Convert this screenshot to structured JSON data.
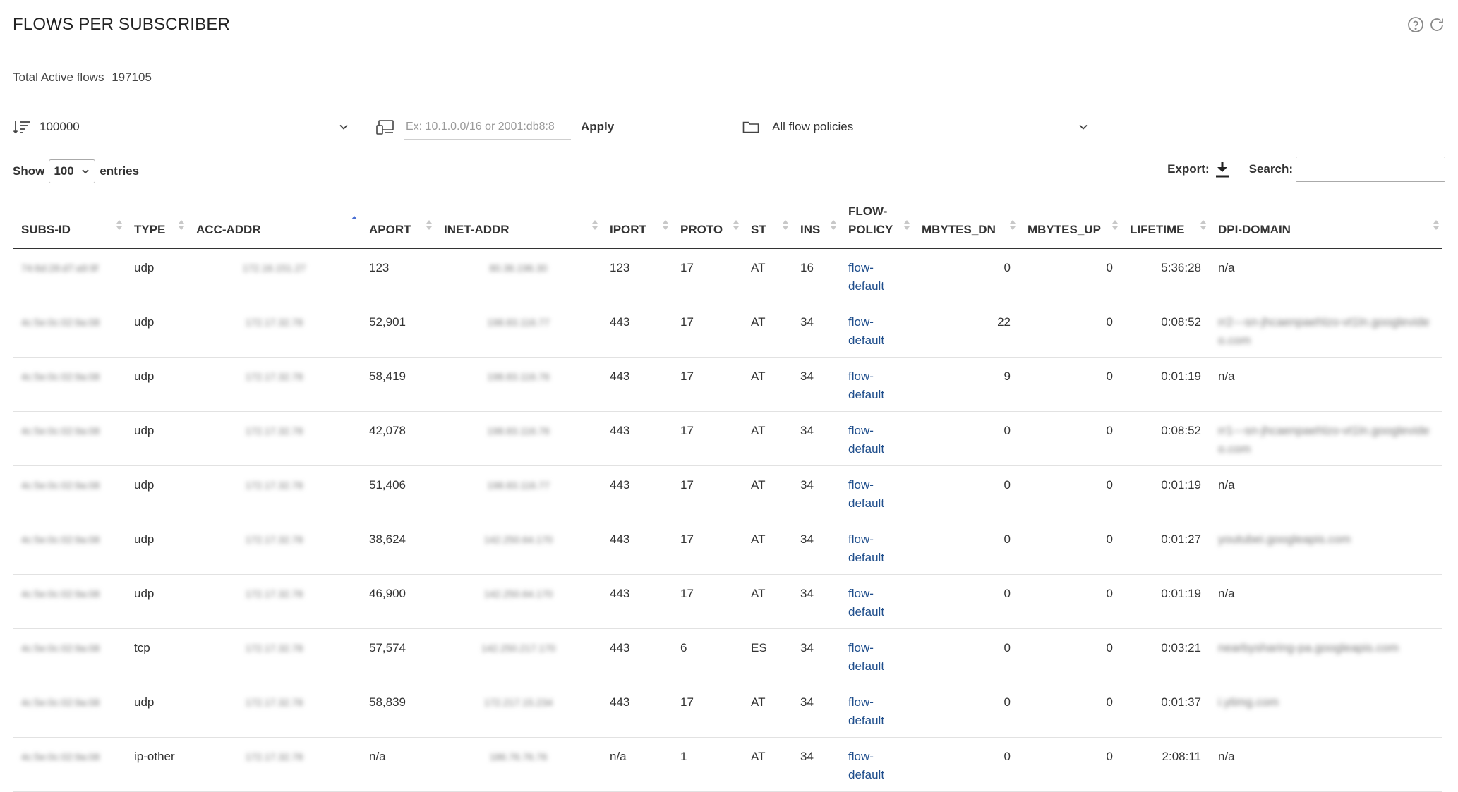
{
  "page": {
    "title": "FLOWS PER SUBSCRIBER"
  },
  "header_icons": [
    "help-circle-icon",
    "refresh-icon"
  ],
  "summary": {
    "label": "Total Active flows",
    "value": "197105"
  },
  "filters": {
    "limit_value": "100000",
    "address_placeholder": "Ex: 10.1.0.0/16 or 2001:db8:8",
    "address_value": "",
    "apply_label": "Apply",
    "policy_value": "All flow policies"
  },
  "table_controls": {
    "show_label": "Show",
    "entries_value": "100",
    "entries_label": "entries",
    "export_label": "Export:",
    "search_label": "Search:",
    "search_value": ""
  },
  "columns": [
    "SUBS-ID",
    "TYPE",
    "ACC-ADDR",
    "APORT",
    "INET-ADDR",
    "IPORT",
    "PROTO",
    "ST",
    "INS",
    "FLOW-POLICY",
    "MBYTES_DN",
    "MBYTES_UP",
    "LIFETIME",
    "DPI-DOMAIN"
  ],
  "sorted_column": "ACC-ADDR",
  "colors": {
    "link": "#1f4e8c",
    "sort_active": "#4a6fd4",
    "sort_idle": "#c8c8c8"
  },
  "rows": [
    {
      "subs_id": "74:6d:28:d7:a9:9f",
      "type": "udp",
      "acc_addr": "172.16.151.27",
      "aport": "123",
      "inet_addr": "80.36.196.30",
      "iport": "123",
      "proto": "17",
      "st": "AT",
      "ins": "16",
      "flow_policy": "flow-default",
      "mbytes_dn": "0",
      "mbytes_up": "0",
      "lifetime": "5:36:28",
      "dpi_domain": "n/a",
      "dpi_blur": false
    },
    {
      "subs_id": "4c:5e:0c:02:9a:08",
      "type": "udp",
      "acc_addr": "172.17.32.78",
      "aport": "52,901",
      "inet_addr": "198.83.116.77",
      "iport": "443",
      "proto": "17",
      "st": "AT",
      "ins": "34",
      "flow_policy": "flow-default",
      "mbytes_dn": "22",
      "mbytes_up": "0",
      "lifetime": "0:08:52",
      "dpi_domain": "rr2---sn-jhcaenpaehlzo-vt1ln.googlevideo.com",
      "dpi_blur": true
    },
    {
      "subs_id": "4c:5e:0c:02:9a:08",
      "type": "udp",
      "acc_addr": "172.17.32.78",
      "aport": "58,419",
      "inet_addr": "198.83.116.76",
      "iport": "443",
      "proto": "17",
      "st": "AT",
      "ins": "34",
      "flow_policy": "flow-default",
      "mbytes_dn": "9",
      "mbytes_up": "0",
      "lifetime": "0:01:19",
      "dpi_domain": "n/a",
      "dpi_blur": false
    },
    {
      "subs_id": "4c:5e:0c:02:9a:08",
      "type": "udp",
      "acc_addr": "172.17.32.78",
      "aport": "42,078",
      "inet_addr": "198.83.116.76",
      "iport": "443",
      "proto": "17",
      "st": "AT",
      "ins": "34",
      "flow_policy": "flow-default",
      "mbytes_dn": "0",
      "mbytes_up": "0",
      "lifetime": "0:08:52",
      "dpi_domain": "rr1---sn-jhcaenpaehlzo-vt1ln.googlevideo.com",
      "dpi_blur": true
    },
    {
      "subs_id": "4c:5e:0c:02:9a:08",
      "type": "udp",
      "acc_addr": "172.17.32.78",
      "aport": "51,406",
      "inet_addr": "198.83.116.77",
      "iport": "443",
      "proto": "17",
      "st": "AT",
      "ins": "34",
      "flow_policy": "flow-default",
      "mbytes_dn": "0",
      "mbytes_up": "0",
      "lifetime": "0:01:19",
      "dpi_domain": "n/a",
      "dpi_blur": false
    },
    {
      "subs_id": "4c:5e:0c:02:9a:08",
      "type": "udp",
      "acc_addr": "172.17.32.78",
      "aport": "38,624",
      "inet_addr": "142.250.64.170",
      "iport": "443",
      "proto": "17",
      "st": "AT",
      "ins": "34",
      "flow_policy": "flow-default",
      "mbytes_dn": "0",
      "mbytes_up": "0",
      "lifetime": "0:01:27",
      "dpi_domain": "youtubei.googleapis.com",
      "dpi_blur": true
    },
    {
      "subs_id": "4c:5e:0c:02:9a:08",
      "type": "udp",
      "acc_addr": "172.17.32.78",
      "aport": "46,900",
      "inet_addr": "142.250.64.170",
      "iport": "443",
      "proto": "17",
      "st": "AT",
      "ins": "34",
      "flow_policy": "flow-default",
      "mbytes_dn": "0",
      "mbytes_up": "0",
      "lifetime": "0:01:19",
      "dpi_domain": "n/a",
      "dpi_blur": false
    },
    {
      "subs_id": "4c:5e:0c:02:9a:08",
      "type": "tcp",
      "acc_addr": "172.17.32.78",
      "aport": "57,574",
      "inet_addr": "142.250.217.170",
      "iport": "443",
      "proto": "6",
      "st": "ES",
      "ins": "34",
      "flow_policy": "flow-default",
      "mbytes_dn": "0",
      "mbytes_up": "0",
      "lifetime": "0:03:21",
      "dpi_domain": "nearbysharing-pa.googleapis.com",
      "dpi_blur": true
    },
    {
      "subs_id": "4c:5e:0c:02:9a:08",
      "type": "udp",
      "acc_addr": "172.17.32.78",
      "aport": "58,839",
      "inet_addr": "172.217.15.234",
      "iport": "443",
      "proto": "17",
      "st": "AT",
      "ins": "34",
      "flow_policy": "flow-default",
      "mbytes_dn": "0",
      "mbytes_up": "0",
      "lifetime": "0:01:37",
      "dpi_domain": "i.ytimg.com",
      "dpi_blur": true
    },
    {
      "subs_id": "4c:5e:0c:02:9a:08",
      "type": "ip-other",
      "acc_addr": "172.17.32.78",
      "aport": "n/a",
      "inet_addr": "186.76.76.76",
      "iport": "n/a",
      "proto": "1",
      "st": "AT",
      "ins": "34",
      "flow_policy": "flow-default",
      "mbytes_dn": "0",
      "mbytes_up": "0",
      "lifetime": "2:08:11",
      "dpi_domain": "n/a",
      "dpi_blur": false
    }
  ]
}
